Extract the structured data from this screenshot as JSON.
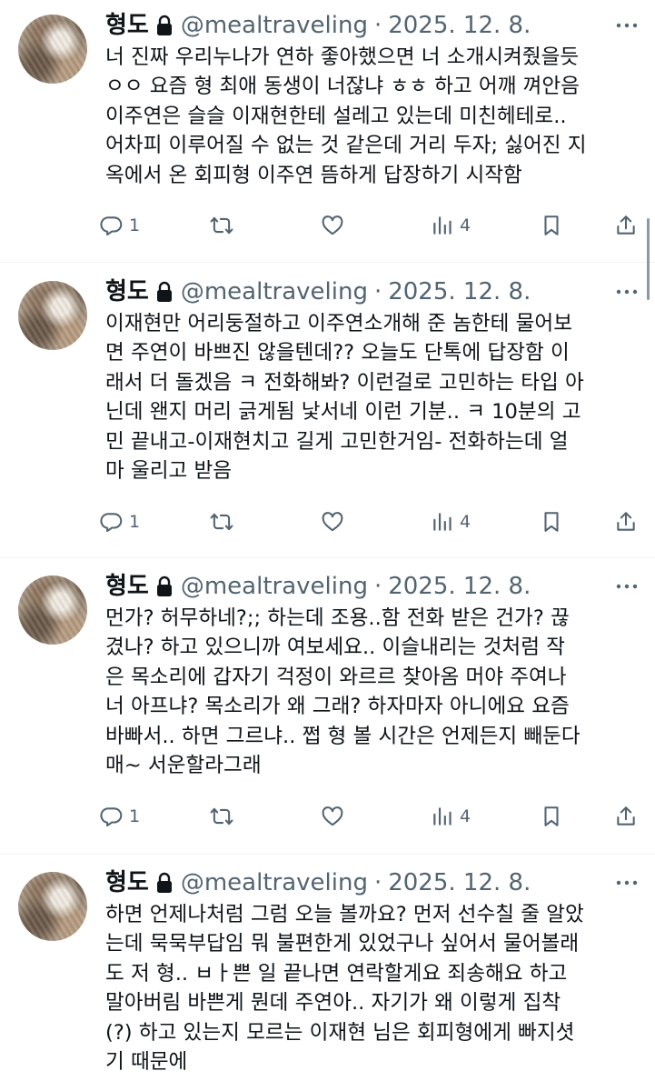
{
  "tweets": [
    {
      "name": "형도",
      "handle": "@mealtraveling",
      "separator": "·",
      "date": "2025. 12. 8.",
      "lines": [
        "너 진짜 우리누나가 연하 좋아했으면 너 소개시켜줬을듯",
        "ㅇㅇ 요즘 형 최애 동생이 너잖냐 ㅎㅎ 하고 어깨 껴안음",
        "이주연은 슬슬 이재현한테 설레고 있는데 미친헤테로..",
        "어차피 이루어질 수 없는 것 같은데 거리 두자; 싫어진 지",
        "옥에서 온 회피형 이주연 뜸하게 답장하기 시작함"
      ],
      "replies": "1",
      "views": "4"
    },
    {
      "name": "형도",
      "handle": "@mealtraveling",
      "separator": "·",
      "date": "2025. 12. 8.",
      "lines": [
        "이재현만 어리둥절하고 이주연소개해 준 놈한테 물어보",
        "면 주연이 바쁘진 않을텐데?? 오늘도 단톡에 답장함 이",
        "래서 더 돌겠음 ㅋ 전화해봐? 이런걸로 고민하는 타입 아",
        "닌데 왠지 머리 긁게됨 낯서네 이런 기분.. ㅋ 10분의 고",
        "민 끝내고-이재현치고 길게 고민한거임- 전화하는데 얼",
        "마 울리고 받음"
      ],
      "replies": "1",
      "views": "4"
    },
    {
      "name": "형도",
      "handle": "@mealtraveling",
      "separator": "·",
      "date": "2025. 12. 8.",
      "lines": [
        "먼가? 허무하네?;; 하는데 조용..함 전화 받은 건가? 끊",
        "겼나? 하고 있으니까 여보세요.. 이슬내리는 것처럼 작",
        "은 목소리에 갑자기 걱정이 와르르 찾아옴 머야 주여나",
        "너 아프냐? 목소리가 왜 그래? 하자마자 아니에요 요즘",
        "바빠서.. 하면 그르냐.. 쩝 형 볼 시간은 언제든지 빼둔다",
        "매~ 서운할라그래"
      ],
      "replies": "1",
      "views": "4"
    },
    {
      "name": "형도",
      "handle": "@mealtraveling",
      "separator": "·",
      "date": "2025. 12. 8.",
      "lines": [
        "하면 언제나처럼 그럼 오늘 볼까요? 먼저 선수칠 줄 알았",
        "는데 묵묵부답임 뭐 불편한게 있었구나 싶어서 물어볼래",
        "도 저 형.. ㅂㅏ쁜 일 끝나면 연락할게요 죄송해요 하고",
        "말아버림 바쁜게 뭔데 주연아.. 자기가 왜 이렇게 집착",
        "(?) 하고 있는지 모르는 이재현 님은 회피형에게 빠지셧",
        "기 때문에"
      ]
    }
  ],
  "icons": {
    "lock": "lock-icon",
    "more": "more-icon",
    "reply": "reply-icon",
    "retweet": "retweet-icon",
    "like": "heart-icon",
    "views": "views-icon",
    "bookmark": "bookmark-icon",
    "share": "share-icon"
  },
  "colors": {
    "text": "#0f1419",
    "secondary": "#536471",
    "divider": "#eff3f4"
  }
}
